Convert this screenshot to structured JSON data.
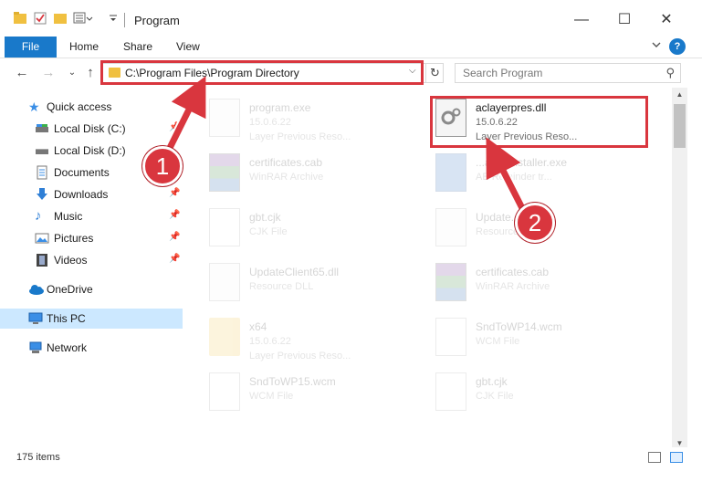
{
  "window": {
    "title": "Program",
    "controls": {
      "minimize": "—",
      "maximize": "☐",
      "close": "✕"
    }
  },
  "ribbon": {
    "tabs": [
      "File",
      "Home",
      "Share",
      "View"
    ],
    "expand_icon": "chevron-down-icon",
    "help_label": "?"
  },
  "nav": {
    "address_path": "C:\\Program Files\\Program Directory",
    "search_placeholder": "Search Program"
  },
  "sidebar": {
    "items": [
      {
        "label": "Quick access",
        "icon": "star-icon",
        "pinned": false
      },
      {
        "label": "Local Disk (C:)",
        "icon": "drive-icon",
        "pinned": true
      },
      {
        "label": "Local Disk (D:)",
        "icon": "drive-icon",
        "pinned": true
      },
      {
        "label": "Documents",
        "icon": "documents-icon",
        "pinned": true
      },
      {
        "label": "Downloads",
        "icon": "download-icon",
        "pinned": true
      },
      {
        "label": "Music",
        "icon": "music-icon",
        "pinned": true
      },
      {
        "label": "Pictures",
        "icon": "pictures-icon",
        "pinned": true
      },
      {
        "label": "Videos",
        "icon": "videos-icon",
        "pinned": true
      },
      {
        "label": "OneDrive",
        "icon": "cloud-icon",
        "pinned": false
      },
      {
        "label": "This PC",
        "icon": "computer-icon",
        "pinned": false,
        "selected": true
      },
      {
        "label": "Network",
        "icon": "network-icon",
        "pinned": false
      }
    ]
  },
  "files": [
    {
      "name": "program.exe",
      "line2": "15.0.6.22",
      "line3": "Layer Previous Reso...",
      "icon": "exe-icon",
      "faded": true
    },
    {
      "name": "aclayerpres.dll",
      "line2": "15.0.6.22",
      "line3": "Layer Previous Reso...",
      "icon": "gear-file-icon",
      "faded": false,
      "highlighted": true
    },
    {
      "name": "certificates.cab",
      "line2": "WinRAR Archive",
      "line3": "",
      "icon": "winrar-icon",
      "faded": true
    },
    {
      "name": "...amminstaller.exe",
      "line2": "AE Reminder tr...",
      "line3": "",
      "icon": "installer-icon",
      "faded": true
    },
    {
      "name": "gbt.cjk",
      "line2": "CJK File",
      "line3": "",
      "icon": "file-icon",
      "faded": true
    },
    {
      "name": "Update...65.dll",
      "line2": "Resource DLL",
      "line3": "",
      "icon": "gear-file-icon",
      "faded": true
    },
    {
      "name": "UpdateClient65.dll",
      "line2": "Resource DLL",
      "line3": "",
      "icon": "gear-file-icon",
      "faded": true
    },
    {
      "name": "certificates.cab",
      "line2": "WinRAR Archive",
      "line3": "",
      "icon": "winrar-icon",
      "faded": true
    },
    {
      "name": "x64",
      "line2": "15.0.6.22",
      "line3": "Layer Previous Reso...",
      "icon": "folder-icon",
      "faded": true
    },
    {
      "name": "SndToWP14.wcm",
      "line2": "WCM File",
      "line3": "",
      "icon": "file-icon",
      "faded": true
    },
    {
      "name": "SndToWP15.wcm",
      "line2": "WCM File",
      "line3": "",
      "icon": "file-icon",
      "faded": true
    },
    {
      "name": "gbt.cjk",
      "line2": "CJK File",
      "line3": "",
      "icon": "file-icon",
      "faded": true
    }
  ],
  "status": {
    "item_count": "175 items"
  },
  "annotations": {
    "badge1": "1",
    "badge2": "2",
    "color": "#d9363e"
  }
}
